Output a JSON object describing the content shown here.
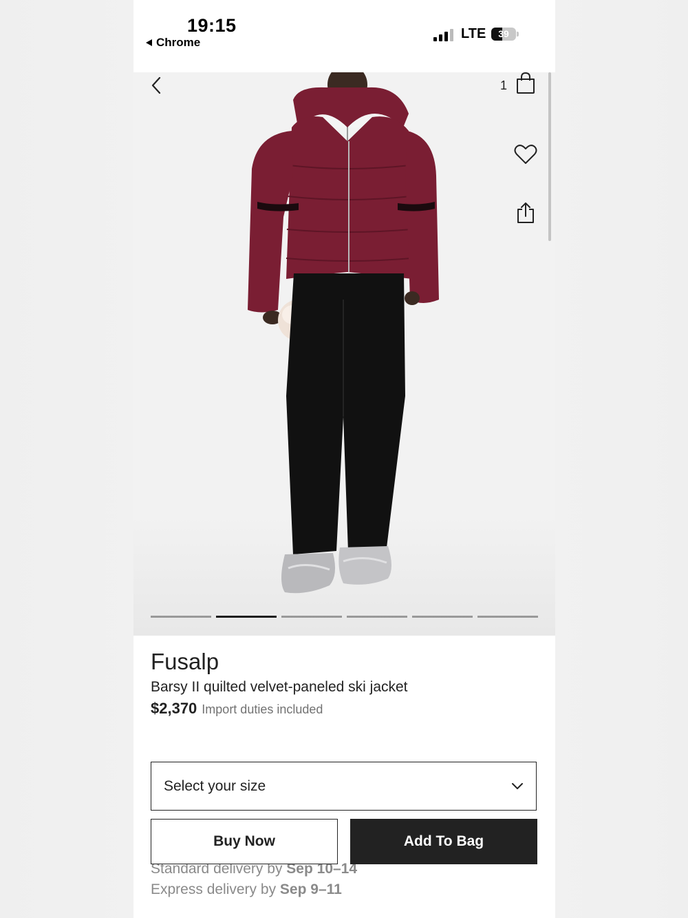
{
  "status_bar": {
    "time": "19:15",
    "back_app": "Chrome",
    "network": "LTE",
    "battery": "39"
  },
  "header": {
    "bag_count": "1"
  },
  "gallery": {
    "image_alt": "Model wearing a burgundy quilted ski jacket with black pants and silver snow boots",
    "jacket_color": "#7a1e33",
    "active_slide": 2,
    "slide_count": 6
  },
  "product": {
    "brand": "Fusalp",
    "name": "Barsy II quilted velvet-paneled ski jacket",
    "price": "$2,370",
    "duties_note": "Import duties included"
  },
  "size_select": {
    "placeholder": "Select your size"
  },
  "actions": {
    "buy_now": "Buy Now",
    "add_to_bag": "Add To Bag"
  },
  "delivery": {
    "standard_prefix": "Standard delivery by",
    "standard_dates": "Sep 10–14",
    "express_prefix": "Express delivery by",
    "express_dates": "Sep 9–11"
  }
}
